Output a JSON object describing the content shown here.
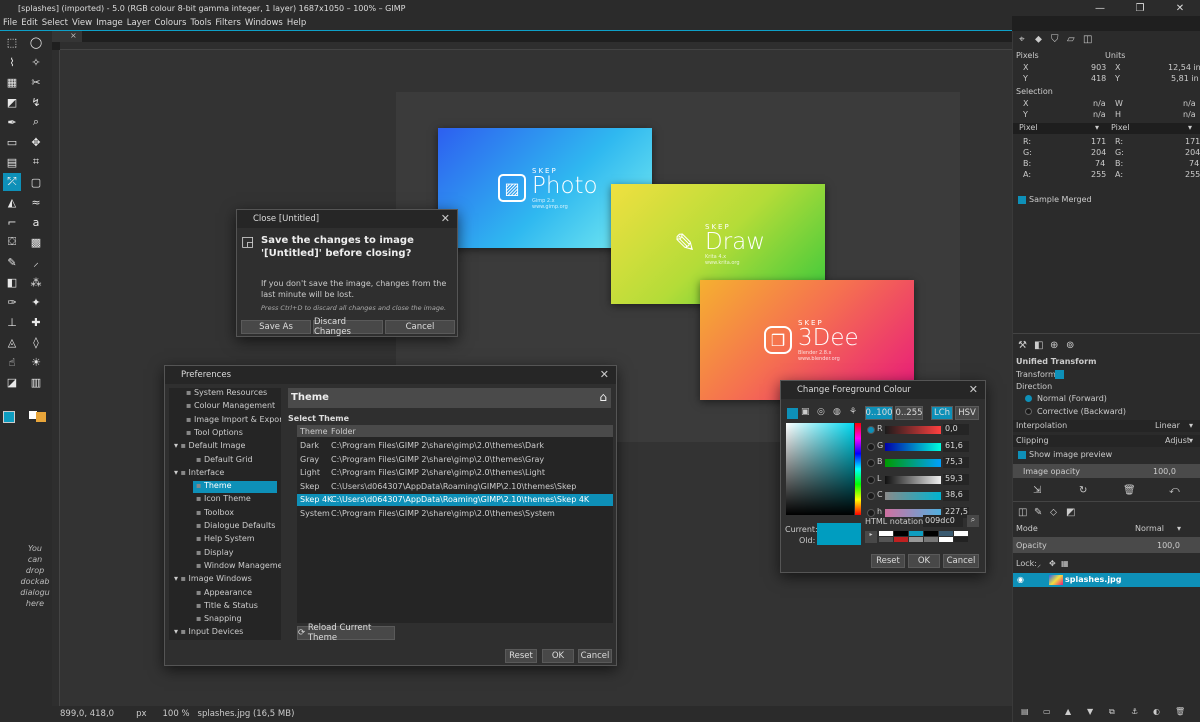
{
  "window": {
    "title": "[splashes] (imported) - 5.0 (RGB colour 8-bit gamma integer, 1 layer) 1687x1050 – 100% – GIMP",
    "minimize": "—",
    "maximize": "❐",
    "close": "✕"
  },
  "menu": [
    "File",
    "Edit",
    "Select",
    "View",
    "Image",
    "Layer",
    "Colours",
    "Tools",
    "Filters",
    "Windows",
    "Help"
  ],
  "toolbox": {
    "drop_hint": [
      "You",
      "can",
      "drop",
      "dockab",
      "dialogu",
      "here"
    ]
  },
  "canvas": {
    "image_tab_close": "×",
    "splashes": [
      {
        "skep": "SKEP",
        "name": "Photo",
        "sub": "Gimp 2.x",
        "url": "www.gimp.org",
        "icon": "▨"
      },
      {
        "skep": "SKEP",
        "name": "Draw",
        "sub": "Krita 4.x",
        "url": "www.krita.org",
        "icon": "✎"
      },
      {
        "skep": "SKEP",
        "name": "3Dee",
        "sub": "Blender 2.8.x",
        "url": "www.blender.org",
        "icon": "❒"
      }
    ]
  },
  "status": {
    "coords": "899,0, 418,0",
    "unit": "px",
    "zoom": "100 %",
    "file": "splashes.jpg (16,5 MB)"
  },
  "pointer": {
    "pixels_label": "Pixels",
    "units_label": "Units",
    "x_label": "X",
    "y_label": "Y",
    "x_px": "903",
    "y_px": "418",
    "x_in": "12,54 in",
    "y_in": "5,81 in",
    "selection_label": "Selection",
    "na": "n/a",
    "w_label": "W",
    "h_label": "H",
    "pixel_mode_a": "Pixel",
    "pixel_mode_b": "Pixel",
    "r_label": "R:",
    "g_label": "G:",
    "b_label": "B:",
    "a_label": "A:",
    "r": "171",
    "g": "204",
    "b": "74",
    "a": "255",
    "sample_merged": "Sample Merged"
  },
  "tool_options": {
    "title": "Unified Transform",
    "transform_label": "Transform:",
    "direction_label": "Direction",
    "normal": "Normal (Forward)",
    "corrective": "Corrective (Backward)",
    "interpolation_label": "Interpolation",
    "interpolation": "Linear",
    "clipping_label": "Clipping",
    "clipping": "Adjust",
    "show_preview": "Show image preview",
    "opacity_label": "Image opacity",
    "opacity": "100,0"
  },
  "layers": {
    "mode_label": "Mode",
    "mode": "Normal",
    "opacity_label": "Opacity",
    "opacity": "100,0",
    "lock_label": "Lock:",
    "layer_name": "splashes.jpg"
  },
  "close_dialog": {
    "title": "Close [Untitled]",
    "heading": "Save the changes to image '[Untitled]' before closing?",
    "body": "If you don't save the image, changes from the last minute will be lost.",
    "hint": "Press Ctrl+D to discard all changes and close the image.",
    "save_as": "Save As",
    "discard": "Discard Changes",
    "cancel": "Cancel"
  },
  "preferences": {
    "title": "Preferences",
    "tree": [
      {
        "label": "System Resources",
        "indent": 1
      },
      {
        "label": "Colour Management",
        "indent": 1
      },
      {
        "label": "Image Import & Export",
        "indent": 1
      },
      {
        "label": "Tool Options",
        "indent": 1
      },
      {
        "label": "Default Image",
        "indent": 0,
        "exp": "▾"
      },
      {
        "label": "Default Grid",
        "indent": 2
      },
      {
        "label": "Interface",
        "indent": 0,
        "exp": "▾"
      },
      {
        "label": "Theme",
        "indent": 2,
        "selected": true
      },
      {
        "label": "Icon Theme",
        "indent": 2
      },
      {
        "label": "Toolbox",
        "indent": 2
      },
      {
        "label": "Dialogue Defaults",
        "indent": 2
      },
      {
        "label": "Help System",
        "indent": 2
      },
      {
        "label": "Display",
        "indent": 2
      },
      {
        "label": "Window Management",
        "indent": 2
      },
      {
        "label": "Image Windows",
        "indent": 0,
        "exp": "▾"
      },
      {
        "label": "Appearance",
        "indent": 2
      },
      {
        "label": "Title & Status",
        "indent": 2
      },
      {
        "label": "Snapping",
        "indent": 2
      },
      {
        "label": "Input Devices",
        "indent": 0,
        "exp": "▾"
      }
    ],
    "section_title": "Theme",
    "select_label": "Select Theme",
    "col_theme": "Theme",
    "col_folder": "Folder",
    "themes": [
      {
        "name": "Dark",
        "folder": "C:\\Program Files\\GIMP 2\\share\\gimp\\2.0\\themes\\Dark"
      },
      {
        "name": "Gray",
        "folder": "C:\\Program Files\\GIMP 2\\share\\gimp\\2.0\\themes\\Gray"
      },
      {
        "name": "Light",
        "folder": "C:\\Program Files\\GIMP 2\\share\\gimp\\2.0\\themes\\Light"
      },
      {
        "name": "Skep",
        "folder": "C:\\Users\\d064307\\AppData\\Roaming\\GIMP\\2.10\\themes\\Skep"
      },
      {
        "name": "Skep 4K",
        "folder": "C:\\Users\\d064307\\AppData\\Roaming\\GIMP\\2.10\\themes\\Skep 4K",
        "selected": true
      },
      {
        "name": "System",
        "folder": "C:\\Program Files\\GIMP 2\\share\\gimp\\2.0\\themes\\System"
      }
    ],
    "reload": "Reload Current Theme",
    "reset": "Reset",
    "ok": "OK",
    "cancel": "Cancel"
  },
  "fg_colour": {
    "title": "Change Foreground Colour",
    "range_a": "0..100",
    "range_b": "0..255",
    "lch": "LCh",
    "hsv": "HSV",
    "channels": [
      {
        "label": "R",
        "value": "0,0",
        "from": "#1b1b1b",
        "to": "#ff4040"
      },
      {
        "label": "G",
        "value": "61,6",
        "from": "#0000aa",
        "to": "#00ffdd"
      },
      {
        "label": "B",
        "value": "75,3",
        "from": "#009c00",
        "to": "#00a0ff"
      },
      {
        "label": "L",
        "value": "59,3",
        "from": "#101010",
        "to": "#f0f0f0"
      },
      {
        "label": "C",
        "value": "38,6",
        "from": "#8a8a8a",
        "to": "#00b4d0"
      },
      {
        "label": "h",
        "value": "227,5",
        "from": "#d070a0",
        "to": "#50b0e0"
      }
    ],
    "html_label": "HTML notation:",
    "html_value": "009dc0",
    "current_label": "Current:",
    "old_label": "Old:",
    "current_color": "#009dc0",
    "reset": "Reset",
    "ok": "OK",
    "cancel": "Cancel"
  },
  "colors": {
    "accent": "#0e90b8",
    "selection": "#0ea0c8"
  }
}
